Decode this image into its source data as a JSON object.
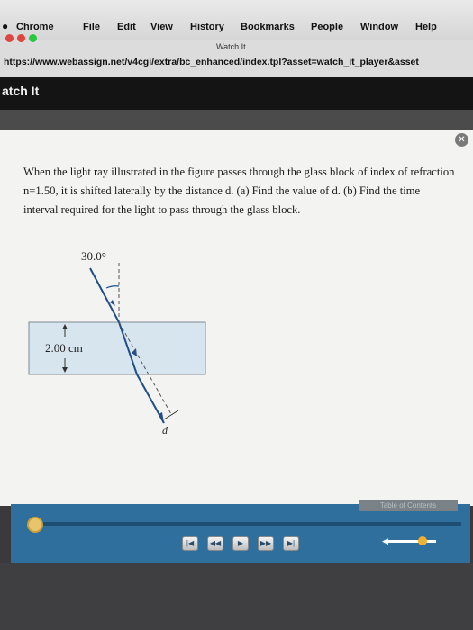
{
  "menubar": {
    "apple_icon": "apple-logo-icon",
    "items": [
      "Chrome",
      "File",
      "Edit",
      "View",
      "History",
      "Bookmarks",
      "People",
      "Window",
      "Help"
    ]
  },
  "window": {
    "title": "Watch It"
  },
  "address_bar": {
    "url": "https://www.webassign.net/v4cgi/extra/bc_enhanced/index.tpl?asset=watch_it_player&asset"
  },
  "page": {
    "heading": "atch It"
  },
  "problem": {
    "text": "When the light ray illustrated in the figure passes through the glass block of index of refraction n=1.50, it is shifted laterally by the distance d. (a) Find the value of d. (b) Find the time interval required for the light to pass through the glass block."
  },
  "figure": {
    "angle_label": "30.0°",
    "thickness_label": "2.00 cm",
    "shift_label": "d"
  },
  "player": {
    "toc_label": "Table of Contents",
    "volume_level": 0.65,
    "controls": [
      "first",
      "rewind",
      "play",
      "fast-forward",
      "last"
    ]
  }
}
